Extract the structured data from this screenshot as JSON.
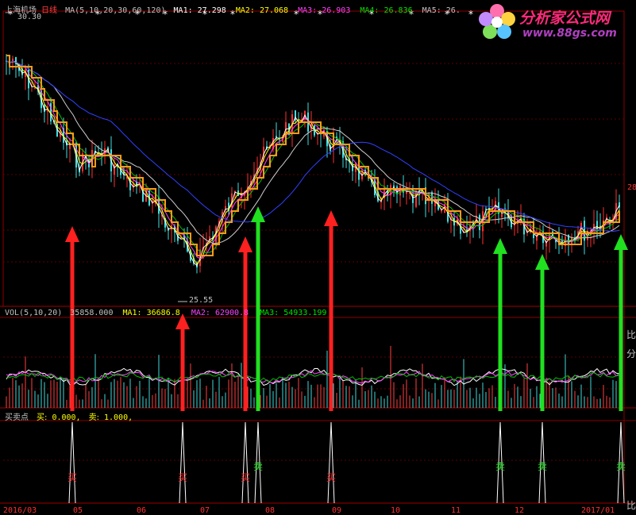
{
  "price_panel": {
    "stock_name": "上海机场",
    "period": "日线",
    "ma_label": "MA(5,10,20,30,60,120)",
    "ma_values": [
      {
        "name": "MA1:",
        "value": "27.298",
        "color": "#ffffff"
      },
      {
        "name": "MA2:",
        "value": "27.068",
        "color": "#ffff00"
      },
      {
        "name": "MA3:",
        "value": "26.903",
        "color": "#ff40ff"
      },
      {
        "name": "MA4:",
        "value": "26.836",
        "color": "#00e000"
      },
      {
        "name": "MA5:",
        "value": "26.",
        "color": "#c0c0c0"
      }
    ],
    "high_label": "30.30",
    "low_label": "25.55",
    "right_edge_label": "28"
  },
  "volume_panel": {
    "label": "VOL(5,10,20)",
    "value": "35858.000",
    "ma_values": [
      {
        "name": "MA1:",
        "value": "36686.8",
        "color": "#ffff00"
      },
      {
        "name": "MA2:",
        "value": "62900.8",
        "color": "#ff40ff"
      },
      {
        "name": "MA3:",
        "value": "54933.199",
        "color": "#00e000"
      }
    ]
  },
  "signal_panel": {
    "label": "买卖点",
    "buy_label": "买:",
    "buy_value": "0.000,",
    "sell_label": "卖:",
    "sell_value": "1.000,"
  },
  "date_axis": [
    "2016/03",
    "05",
    "06",
    "07",
    "08",
    "09",
    "10",
    "11",
    "12",
    "2017/01"
  ],
  "right_side_labels": [
    "比",
    "分",
    "比"
  ],
  "watermark": {
    "site_name": "分析家公式网",
    "url": "www.88gs.com"
  },
  "chart_data": {
    "type": "candlestick",
    "price_range": [
      25.55,
      30.3
    ],
    "buy_signals": [
      {
        "label": "买",
        "approx_date": "2016-05"
      },
      {
        "label": "买",
        "approx_date": "2016-07"
      },
      {
        "label": "买",
        "approx_date": "2016-08"
      },
      {
        "label": "买",
        "approx_date": "2016-09"
      }
    ],
    "sell_signals": [
      {
        "label": "卖",
        "approx_date": "2016-08"
      },
      {
        "label": "卖",
        "approx_date": "2016-12"
      },
      {
        "label": "卖",
        "approx_date": "2016-12"
      },
      {
        "label": "卖",
        "approx_date": "2017-01"
      }
    ],
    "colors": {
      "buy": "#ff2020",
      "sell": "#20e020",
      "up": "#ff3030",
      "down": "#40e0e0"
    }
  }
}
